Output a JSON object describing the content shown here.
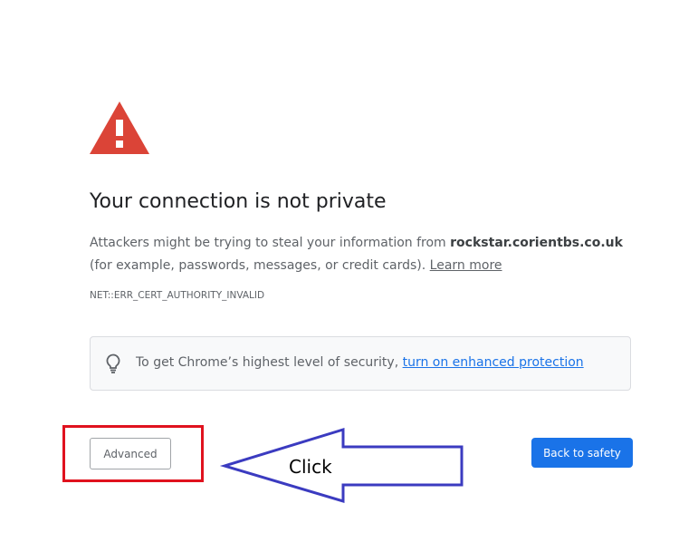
{
  "interstitial": {
    "title": "Your connection is not private",
    "explanation_prefix": "Attackers might be trying to steal your information from ",
    "domain": "rockstar.corientbs.co.uk",
    "explanation_suffix": " (for example, passwords, messages, or credit cards). ",
    "learn_more": "Learn more",
    "error_code": "NET::ERR_CERT_AUTHORITY_INVALID",
    "enhanced_prefix": "To get Chrome’s highest level of security, ",
    "enhanced_link": "turn on enhanced protection",
    "advanced_button": "Advanced",
    "back_button": "Back to safety",
    "icons": {
      "warning": "warning-triangle-icon",
      "bulb": "lightbulb-icon"
    },
    "colors": {
      "warning_red": "#db4437",
      "primary_blue": "#1a73e8",
      "link_blue": "#1a73e8"
    }
  },
  "annotation": {
    "arrow_label": "Click",
    "colors": {
      "highlight_red": "#e0121e",
      "arrow_blue": "#3b3bc0"
    }
  }
}
